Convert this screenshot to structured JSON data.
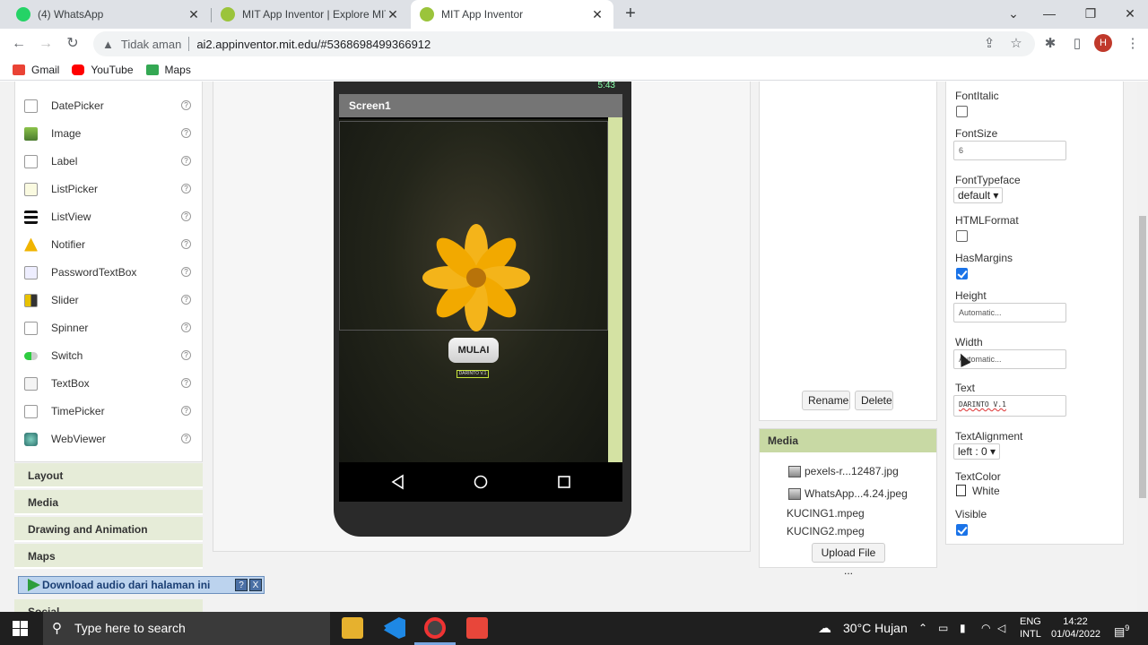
{
  "browser": {
    "tabs": [
      {
        "title": "(4) WhatsApp",
        "icon": "whatsapp-icon",
        "active": false
      },
      {
        "title": "MIT App Inventor | Explore MIT A",
        "icon": "app-inventor-icon",
        "active": false
      },
      {
        "title": "MIT App Inventor",
        "icon": "app-inventor-icon",
        "active": true
      }
    ],
    "security_label": "Tidak aman",
    "url": "ai2.appinventor.mit.edu/#5368698499366912",
    "profile_initial": "H",
    "bookmarks": [
      "Gmail",
      "YouTube",
      "Maps"
    ]
  },
  "palette": {
    "items": [
      "DatePicker",
      "Image",
      "Label",
      "ListPicker",
      "ListView",
      "Notifier",
      "PasswordTextBox",
      "Slider",
      "Spinner",
      "Switch",
      "TextBox",
      "TimePicker",
      "WebViewer"
    ],
    "help_glyph": "?",
    "drawers": [
      "Layout",
      "Media",
      "Drawing and Animation",
      "Maps",
      "Social"
    ]
  },
  "download_bar": {
    "label": "Download audio dari halaman ini",
    "help": "?",
    "close": "X"
  },
  "viewer": {
    "status_time": "5:43",
    "screen_title": "Screen1",
    "button_label": "MULAI",
    "tiny_label": "DARINTO V.1"
  },
  "components": {
    "rename_label": "Rename",
    "delete_label": "Delete"
  },
  "media": {
    "title": "Media",
    "files": [
      "pexels-r...12487.jpg",
      "WhatsApp...4.24.jpeg",
      "KUCING1.mpeg",
      "KUCING2.mpeg"
    ],
    "upload_label": "Upload File ..."
  },
  "properties": {
    "font_italic": {
      "label": "FontItalic",
      "checked": false
    },
    "font_size": {
      "label": "FontSize",
      "value": "6"
    },
    "font_typeface": {
      "label": "FontTypeface",
      "value": "default ▾"
    },
    "html_format": {
      "label": "HTMLFormat",
      "checked": false
    },
    "has_margins": {
      "label": "HasMargins",
      "checked": true
    },
    "height": {
      "label": "Height",
      "value": "Automatic..."
    },
    "width": {
      "label": "Width",
      "value": "Automatic..."
    },
    "text": {
      "label": "Text",
      "value": "DARINTO V.1"
    },
    "text_alignment": {
      "label": "TextAlignment",
      "value": "left : 0 ▾"
    },
    "text_color": {
      "label": "TextColor",
      "value": "White"
    },
    "visible": {
      "label": "Visible",
      "checked": true
    }
  },
  "taskbar": {
    "search_placeholder": "Type here to search",
    "weather": "30°C  Hujan",
    "lang": "ENG",
    "layout": "INTL",
    "time": "14:22",
    "date": "01/04/2022",
    "notifications": "9"
  },
  "colors": {
    "accent_green": "#c8d9a4",
    "drawer_bg": "#e6ecd8",
    "checkbox_blue": "#1a73e8"
  }
}
